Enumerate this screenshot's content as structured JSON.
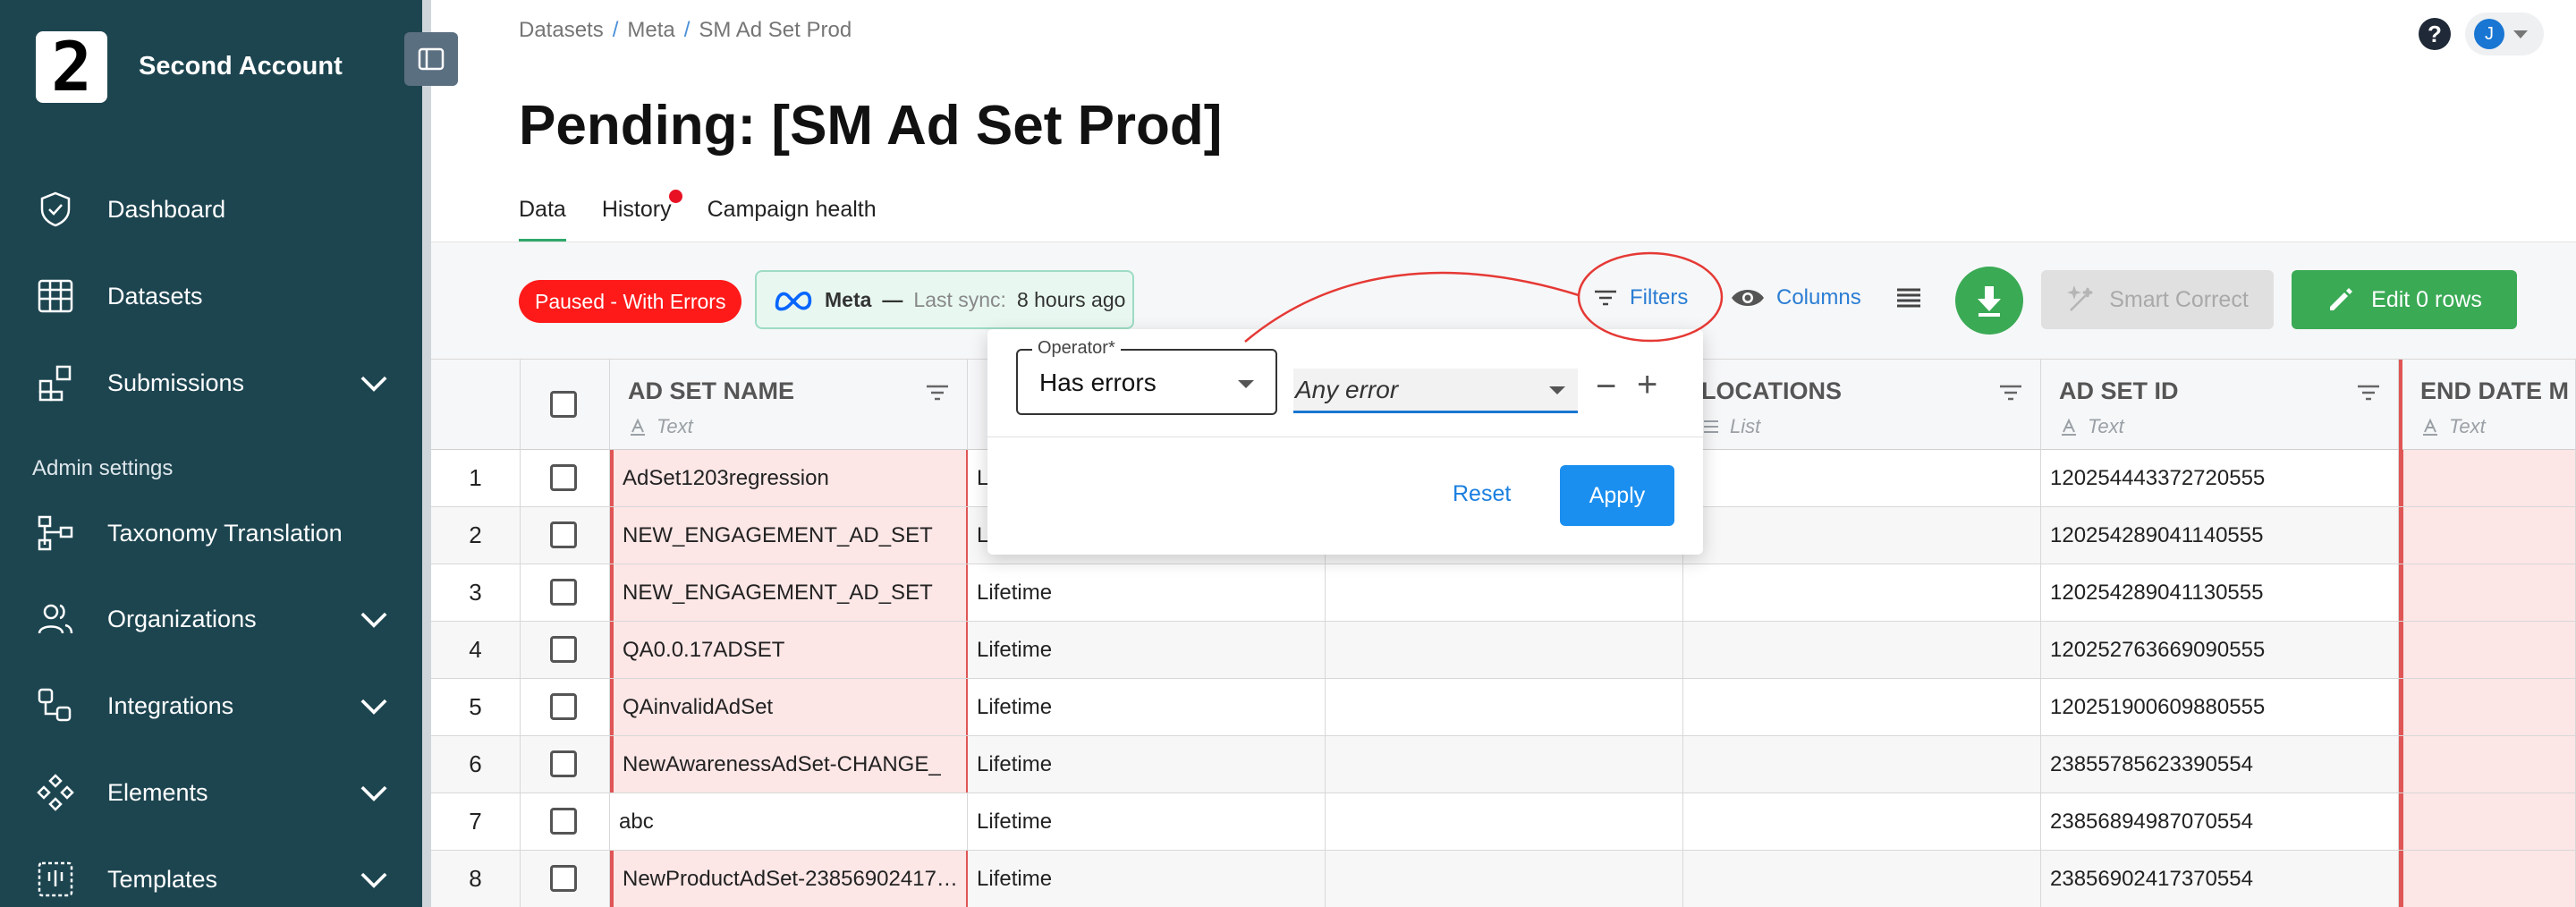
{
  "sidebar": {
    "logo_text": "2",
    "account_name": "Second Account",
    "items": [
      {
        "label": "Dashboard",
        "icon": "shield-check-icon"
      },
      {
        "label": "Datasets",
        "icon": "table-icon"
      },
      {
        "label": "Submissions",
        "icon": "blocks-icon"
      }
    ],
    "admin_label": "Admin settings",
    "admin_items": [
      {
        "label": "Taxonomy Translation",
        "icon": "flow-icon"
      },
      {
        "label": "Organizations",
        "icon": "users-icon"
      },
      {
        "label": "Integrations",
        "icon": "integrations-icon"
      },
      {
        "label": "Elements",
        "icon": "diamond-grid-icon"
      },
      {
        "label": "Templates",
        "icon": "template-icon"
      }
    ]
  },
  "header": {
    "breadcrumb": [
      "Datasets",
      "Meta",
      "SM Ad Set Prod"
    ],
    "breadcrumb_sep": "/",
    "help": "?",
    "user_initial": "J",
    "title": "Pending: [SM Ad Set Prod]"
  },
  "tabs": [
    {
      "label": "Data",
      "active": true
    },
    {
      "label": "History",
      "notification": true
    },
    {
      "label": "Campaign health"
    }
  ],
  "toolbar": {
    "status_badge": "Paused - With Errors",
    "sync_brand": "Meta",
    "sync_dash": "—",
    "sync_label": "Last sync:",
    "sync_value": "8 hours ago",
    "filters_label": "Filters",
    "columns_label": "Columns",
    "smart_correct_label": "Smart Correct",
    "edit_label": "Edit 0 rows"
  },
  "filter_popover": {
    "operator_label": "Operator",
    "operator_required": "*",
    "operator_value": "Has errors",
    "value": "Any error",
    "minus": "−",
    "plus": "+",
    "reset_label": "Reset",
    "apply_label": "Apply"
  },
  "grid": {
    "columns": [
      {
        "title": "AD SET NAME",
        "type": "Text"
      },
      {
        "title": "LOCATIONS",
        "type": "List"
      },
      {
        "title": "AD SET ID",
        "type": "Text"
      },
      {
        "title": "END DATE M",
        "type": "Text"
      }
    ],
    "rows": [
      {
        "num": "1",
        "name": "AdSet1203regression",
        "budget": "Lifetime",
        "id": "120254443372720555",
        "name_error": true
      },
      {
        "num": "2",
        "name": "NEW_ENGAGEMENT_AD_SET",
        "budget": "Lifetime",
        "id": "120254289041140555",
        "name_error": true
      },
      {
        "num": "3",
        "name": "NEW_ENGAGEMENT_AD_SET",
        "budget": "Lifetime",
        "id": "120254289041130555",
        "name_error": true
      },
      {
        "num": "4",
        "name": "QA0.0.17ADSET",
        "budget": "Lifetime",
        "id": "120252763669090555",
        "name_error": true
      },
      {
        "num": "5",
        "name": "QAinvalidAdSet",
        "budget": "Lifetime",
        "id": "120251900609880555",
        "name_error": true
      },
      {
        "num": "6",
        "name": "NewAwarenessAdSet-CHANGE_",
        "budget": "Lifetime",
        "id": "23855785623390554",
        "name_error": true
      },
      {
        "num": "7",
        "name": "abc",
        "budget": "Lifetime",
        "id": "23856894987070554",
        "name_error": false
      },
      {
        "num": "8",
        "name": "NewProductAdSet-23856902417…",
        "budget": "Lifetime",
        "id": "23856902417370554",
        "name_error": true
      }
    ]
  },
  "colors": {
    "sidebar_bg": "#1d4550",
    "accent_green": "#3aaa55",
    "error_red": "#ff1a1a",
    "link_blue": "#2a7dd4"
  }
}
